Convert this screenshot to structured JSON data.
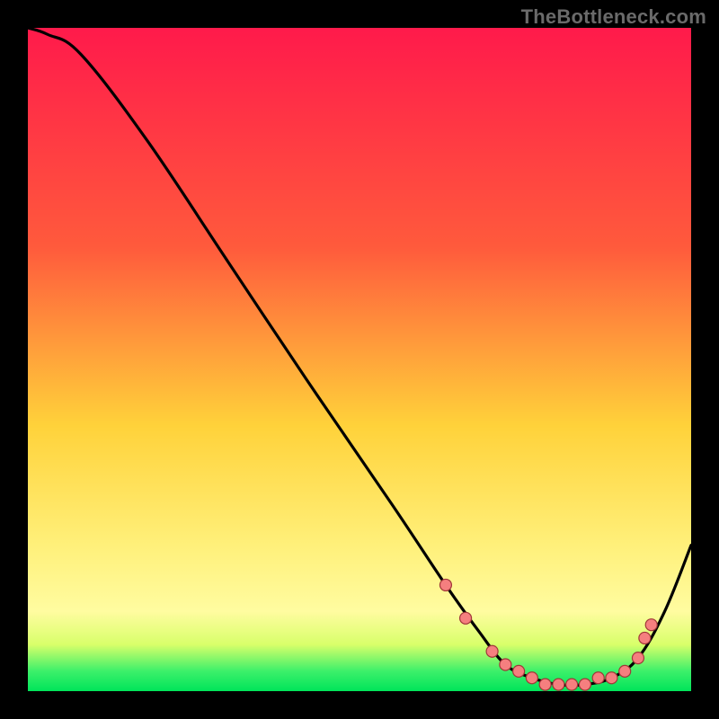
{
  "watermark": "TheBottleneck.com",
  "chart_data": {
    "type": "line",
    "title": "",
    "xlabel": "",
    "ylabel": "",
    "xlim": [
      0,
      100
    ],
    "ylim": [
      0,
      100
    ],
    "series": [
      {
        "name": "bottleneck-curve",
        "x": [
          0,
          3,
          8,
          18,
          30,
          42,
          55,
          63,
          68,
          72,
          76,
          80,
          84,
          88,
          92,
          96,
          100
        ],
        "y": [
          100,
          99,
          96,
          83,
          65,
          47,
          28,
          16,
          9,
          4,
          2,
          1,
          1,
          2,
          5,
          12,
          22
        ]
      }
    ],
    "markers": {
      "name": "highlight-points",
      "x": [
        63,
        66,
        70,
        72,
        74,
        76,
        78,
        80,
        82,
        84,
        86,
        88,
        90,
        92,
        93,
        94
      ],
      "y": [
        16,
        11,
        6,
        4,
        3,
        2,
        1,
        1,
        1,
        1,
        2,
        2,
        3,
        5,
        8,
        10
      ]
    },
    "colors": {
      "curve": "#000000",
      "marker_fill": "#f57f7f",
      "marker_stroke": "#a03838",
      "gradient_top": "#ff1a4b",
      "gradient_mid1": "#ff5a3c",
      "gradient_mid2": "#ffd23a",
      "gradient_mid3": "#fffca0",
      "gradient_bottom": "#00e45a"
    }
  }
}
